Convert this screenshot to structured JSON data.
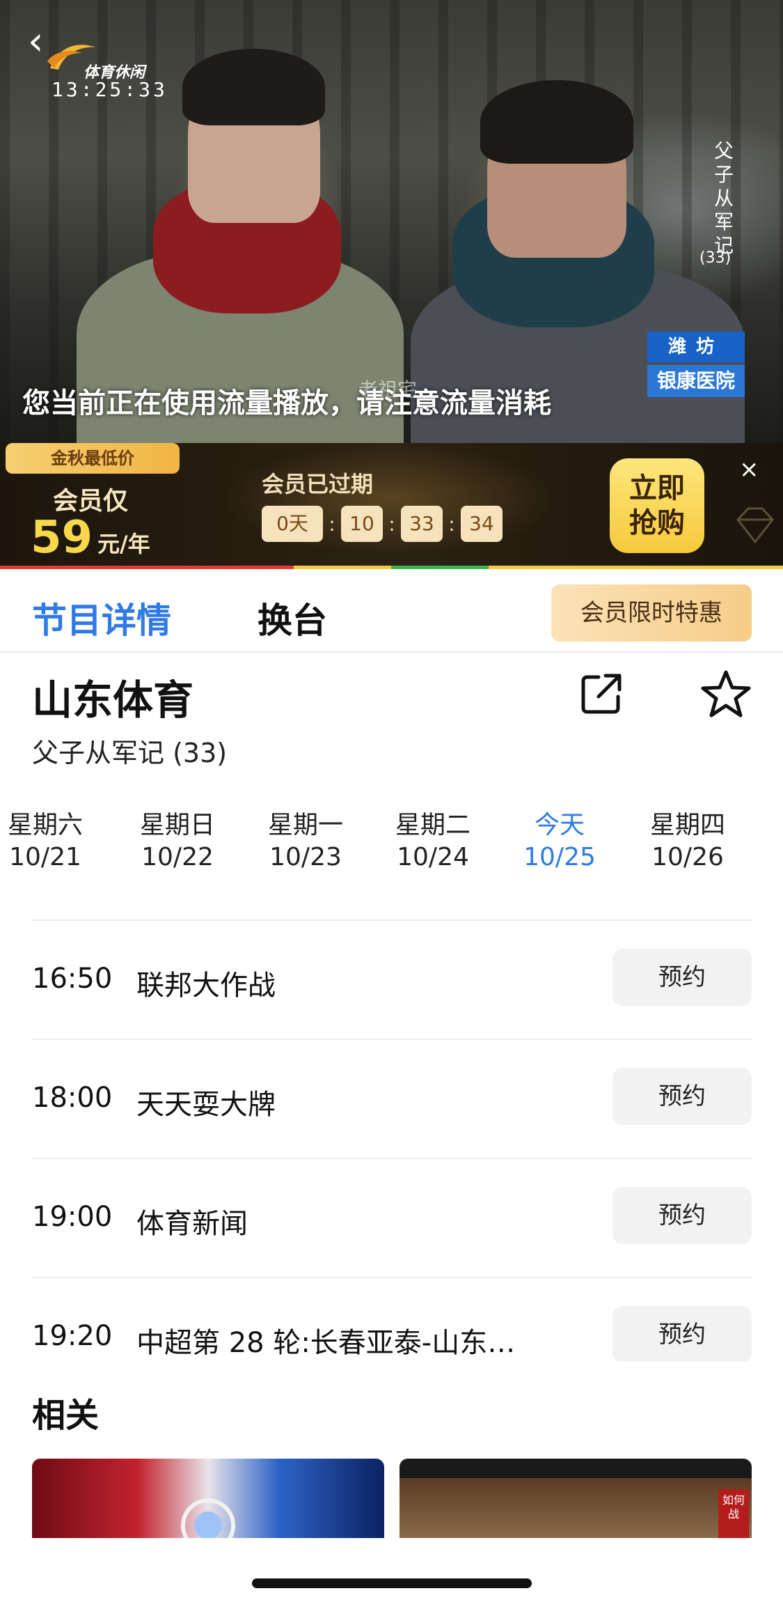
{
  "player": {
    "logo_text": "体育休闲",
    "clock": "13:25:33",
    "episode_vertical": "父子从军记",
    "episode_num": "(33)",
    "station_line1": "潍坊",
    "station_line2": "银康医院",
    "watermark": "老祖宅",
    "traffic_tip": "您当前正在使用流量播放，请注意流量消耗"
  },
  "promo": {
    "tag": "金秋最低价",
    "vip_label": "会员仅",
    "price": "59",
    "unit": "元/年",
    "expired": "会员已过期",
    "countdown": {
      "days": "0天",
      "hours": "10",
      "minutes": "33",
      "seconds": "34",
      "sep": ":"
    },
    "buy_line1": "立即",
    "buy_line2": "抢购",
    "close": "×"
  },
  "tabs": {
    "details": "节目详情",
    "switch": "换台",
    "vip_offer": "会员限时特惠"
  },
  "channel": {
    "name": "山东体育",
    "now_playing": "父子从军记 (33)"
  },
  "dates": [
    {
      "day": "星期六",
      "date": "10/21"
    },
    {
      "day": "星期日",
      "date": "10/22"
    },
    {
      "day": "星期一",
      "date": "10/23"
    },
    {
      "day": "星期二",
      "date": "10/24"
    },
    {
      "day": "今天",
      "date": "10/25",
      "active": true
    },
    {
      "day": "星期四",
      "date": "10/26"
    }
  ],
  "schedule": [
    {
      "time": "16:50",
      "title": "联邦大作战",
      "action": "预约"
    },
    {
      "time": "18:00",
      "title": "天天耍大牌",
      "action": "预约"
    },
    {
      "time": "19:00",
      "title": "体育新闻",
      "action": "预约"
    },
    {
      "time": "19:20",
      "title": "中超第 28 轮:长春亚泰-山东…",
      "action": "预约"
    }
  ],
  "related": {
    "title": "相关",
    "thumb2_badge": "如何战"
  },
  "colors": {
    "accent": "#2f7ae5",
    "promo_gold": "#f7d84a",
    "progress_red": "#e23a32",
    "progress_green": "#3bb54a"
  }
}
